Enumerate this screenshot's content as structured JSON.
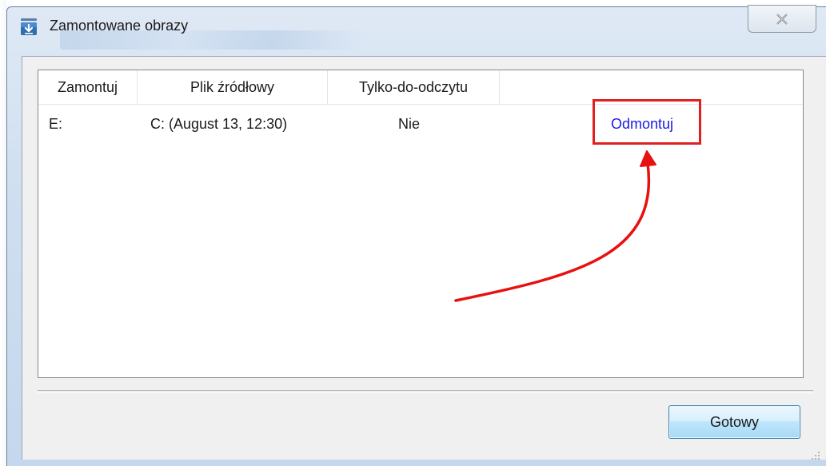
{
  "window": {
    "title": "Zamontowane obrazy",
    "close_icon": "close-icon",
    "app_icon": "drive-download-icon"
  },
  "table": {
    "columns": [
      "Zamontuj",
      "Plik źródłowy",
      "Tylko-do-odczytu"
    ],
    "rows": [
      {
        "mount": "E:",
        "source": "C: (August 13, 12:30)",
        "read_only": "Nie",
        "action": "Odmontuj"
      }
    ]
  },
  "footer": {
    "done_label": "Gotowy"
  },
  "annotation": {
    "highlight_color": "#e02020"
  },
  "colors": {
    "link": "#1a1ae6",
    "accent_button": "#3c7fb1"
  }
}
